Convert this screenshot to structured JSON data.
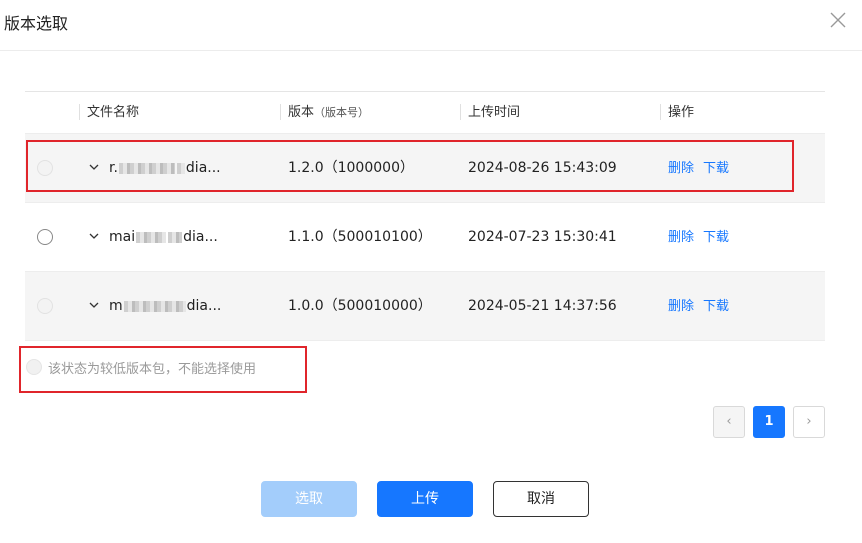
{
  "dialog": {
    "title": "版本选取"
  },
  "table": {
    "headers": {
      "name": "文件名称",
      "version": "版本",
      "version_sub": "（版本号）",
      "time": "上传时间",
      "ops": "操作"
    },
    "rows": [
      {
        "name_prefix": "r.",
        "name_suffix": "dia...",
        "version": "1.2.0（1000000）",
        "time": "2024-08-26 15:43:09",
        "delete": "删除",
        "download": "下载",
        "state": "disabled"
      },
      {
        "name_prefix": "mai",
        "name_suffix": "dia...",
        "version": "1.1.0（500010100）",
        "time": "2024-07-23 15:30:41",
        "delete": "删除",
        "download": "下载",
        "state": "enabled"
      },
      {
        "name_prefix": "m",
        "name_suffix": "dia...",
        "version": "1.0.0（500010000）",
        "time": "2024-05-21 14:37:56",
        "delete": "删除",
        "download": "下载",
        "state": "disabled"
      }
    ]
  },
  "legend": {
    "text": "该状态为较低版本包，不能选择使用"
  },
  "pagination": {
    "prev": "‹",
    "current": "1",
    "next": "›"
  },
  "footer": {
    "select_label": "选取",
    "upload_label": "上传",
    "cancel_label": "取消"
  },
  "colors": {
    "primary": "#1677ff",
    "primary_disabled": "#a3cdfb",
    "highlight_border": "#e0252b"
  }
}
